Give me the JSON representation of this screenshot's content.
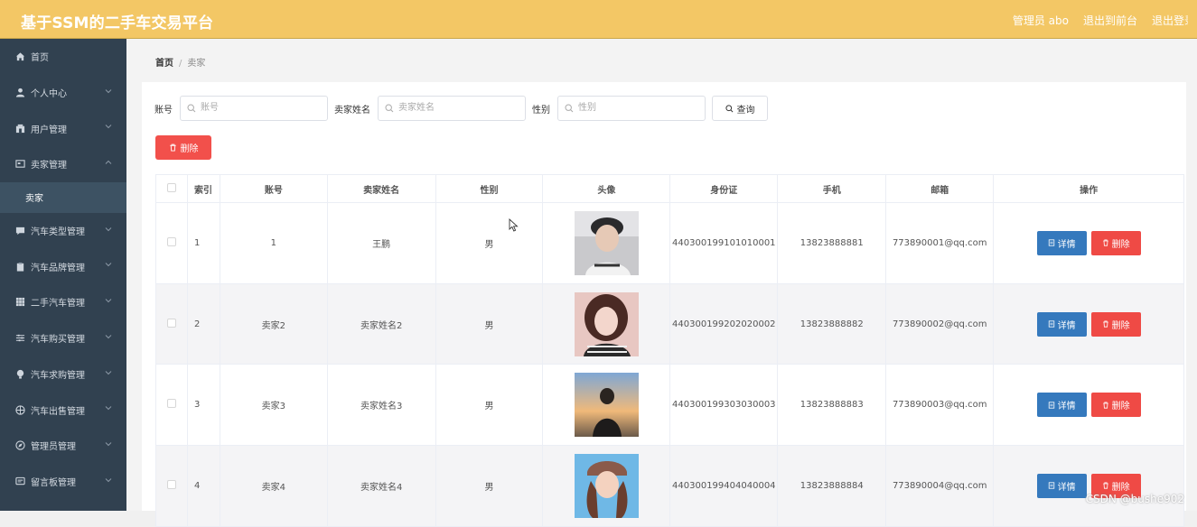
{
  "header": {
    "title": "基于SSM的二手车交易平台",
    "admin_label": "管理员 abo",
    "exit_front": "退出到前台",
    "exit_login": "退出登录"
  },
  "sidebar": {
    "items": [
      {
        "label": "首页",
        "icon": "home-icon"
      },
      {
        "label": "个人中心",
        "icon": "user-icon"
      },
      {
        "label": "用户管理",
        "icon": "shop-icon"
      },
      {
        "label": "卖家管理",
        "icon": "id-card-icon"
      },
      {
        "label": "汽车类型管理",
        "icon": "chat-icon"
      },
      {
        "label": "汽车品牌管理",
        "icon": "clipboard-icon"
      },
      {
        "label": "二手汽车管理",
        "icon": "grid-icon"
      },
      {
        "label": "汽车购买管理",
        "icon": "sliders-icon"
      },
      {
        "label": "汽车求购管理",
        "icon": "bulb-icon"
      },
      {
        "label": "汽车出售管理",
        "icon": "globe-icon"
      },
      {
        "label": "管理员管理",
        "icon": "compass-icon"
      },
      {
        "label": "留言板管理",
        "icon": "message-icon"
      }
    ],
    "sub_item": "卖家"
  },
  "breadcrumb": {
    "home": "首页",
    "separator": "/",
    "current": "卖家"
  },
  "search": {
    "account_label": "账号",
    "account_placeholder": "账号",
    "name_label": "卖家姓名",
    "name_placeholder": "卖家姓名",
    "gender_label": "性别",
    "gender_placeholder": "性别",
    "query_button": "查询"
  },
  "delete_button": "删除",
  "table": {
    "headers": [
      "索引",
      "账号",
      "卖家姓名",
      "性别",
      "头像",
      "身份证",
      "手机",
      "邮箱",
      "操作"
    ],
    "detail_label": "详情",
    "delete_label": "删除",
    "rows": [
      {
        "index": "1",
        "account": "1",
        "name": "王鹏",
        "gender": "男",
        "idcard": "440300199101010001",
        "phone": "13823888881",
        "email": "773890001@qq.com"
      },
      {
        "index": "2",
        "account": "卖家2",
        "name": "卖家姓名2",
        "gender": "男",
        "idcard": "440300199202020002",
        "phone": "13823888882",
        "email": "773890002@qq.com"
      },
      {
        "index": "3",
        "account": "卖家3",
        "name": "卖家姓名3",
        "gender": "男",
        "idcard": "440300199303030003",
        "phone": "13823888883",
        "email": "773890003@qq.com"
      },
      {
        "index": "4",
        "account": "卖家4",
        "name": "卖家姓名4",
        "gender": "男",
        "idcard": "440300199404040004",
        "phone": "13823888884",
        "email": "773890004@qq.com"
      }
    ]
  },
  "watermark": "CSDN @bushe902",
  "colors": {
    "header": "#f3c765",
    "sidebar": "#314150",
    "primary": "#3579bd",
    "danger": "#ef4a45"
  }
}
